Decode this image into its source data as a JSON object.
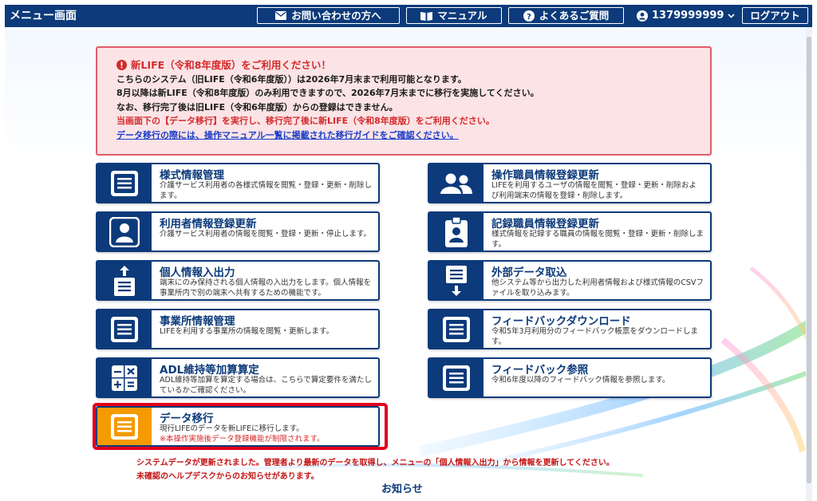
{
  "header": {
    "title": "メニュー画面",
    "contact_label": "お問い合わせの方へ",
    "manual_label": "マニュアル",
    "faq_label": "よくあるご質問",
    "user_id": "1379999999",
    "logout_label": "ログアウト"
  },
  "notice": {
    "title": "新LIFE（令和8年度版）をご利用ください！",
    "line1": "こちらのシステム（旧LIFE（令和6年度版））は2026年7月末まで利用可能となります。",
    "line2": "8月以降は新LIFE（令和8年度版）のみ利用できますので、2026年7月末までに移行を実施してください。",
    "line3": "なお、移行完了後は旧LIFE（令和6年度版）からの登録はできません。",
    "line4": "当画面下の【データ移行】を実行し、移行完了後に新LIFE（令和8年度版）をご利用ください。",
    "link": "データ移行の際には、操作マニュアル一覧に掲載された移行ガイドをご確認ください。"
  },
  "menu": [
    {
      "title": "様式情報管理",
      "desc": "介護サービス利用者の各様式情報を閲覧・登録・更新・削除します。",
      "icon": "document-icon"
    },
    {
      "title": "操作職員情報登録更新",
      "desc": "LIFEを利用するユーザの情報を閲覧・登録・更新・削除および利用端末の情報を登録・削除します。",
      "icon": "users-icon"
    },
    {
      "title": "利用者情報登録更新",
      "desc": "介護サービス利用者の情報を閲覧・登録・更新・停止します。",
      "icon": "person-icon"
    },
    {
      "title": "記録職員情報登録更新",
      "desc": "様式情報を記録する職員の情報を閲覧・登録・更新・削除します。",
      "icon": "id-badge-icon"
    },
    {
      "title": "個人情報入出力",
      "desc": "端末にのみ保持される個人情報の入出力をします。個人情報を事業所内で別の端末へ共有するための機能です。",
      "icon": "upload-clipboard-icon"
    },
    {
      "title": "外部データ取込",
      "desc": "他システム等から出力した利用者情報および様式情報のCSVファイルを取り込みます。",
      "icon": "download-doc-icon"
    },
    {
      "title": "事業所情報管理",
      "desc": "LIFEを利用する事業所の情報を閲覧・更新します。",
      "icon": "document-icon"
    },
    {
      "title": "フィードバックダウンロード",
      "desc": "令和5年3月利用分のフィードバック帳票をダウンロードします。",
      "icon": "document-icon"
    },
    {
      "title": "ADL維持等加算算定",
      "desc": "ADL維持等加算を算定する場合は、こちらで算定要件を満たしているかご確認ください。",
      "icon": "calculator-icon"
    },
    {
      "title": "フィードバック参照",
      "desc": "令和6年度以降のフィードバック情報を参照します。",
      "icon": "document-icon"
    }
  ],
  "data_migration": {
    "title": "データ移行",
    "desc": "現行LIFEのデータを新LIFEに移行します。",
    "warning": "※本操作実施後データ登録機能が制限されます。"
  },
  "messages": {
    "msg1": "システムデータが更新されました。管理者より最新のデータを取得し、メニューの「個人情報入出力」から情報を更新してください。",
    "msg2": "未確認のヘルプデスクからのお知らせがあります。"
  },
  "announcements_label": "お知らせ",
  "colors": {
    "navy": "#0c3a7a",
    "alert_red": "#d32a2a",
    "orange": "#f59a00"
  }
}
